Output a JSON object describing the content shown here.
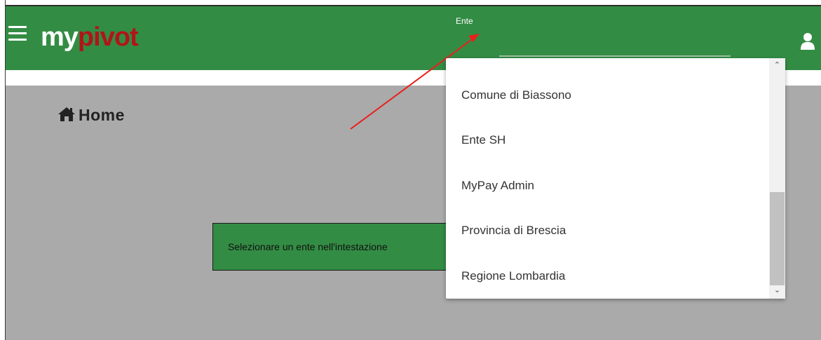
{
  "header": {
    "logo": {
      "my": "my",
      "pivot": "pivot"
    },
    "ente_label": "Ente",
    "user_icon": "user-icon",
    "menu_icon": "hamburger-icon",
    "color": "#338c44"
  },
  "page": {
    "title": "Home",
    "title_icon": "home-icon",
    "notice": "Selezionare un ente nell'intestazione"
  },
  "dropdown": {
    "items": [
      "Comune di Biassono",
      "Ente SH",
      "MyPay Admin",
      "Provincia di Brescia",
      "Regione Lombardia"
    ]
  },
  "colors": {
    "header_green": "#338c44",
    "logo_red": "#b01518",
    "main_bg": "#aaaaaa",
    "arrow": "#e8211e"
  }
}
